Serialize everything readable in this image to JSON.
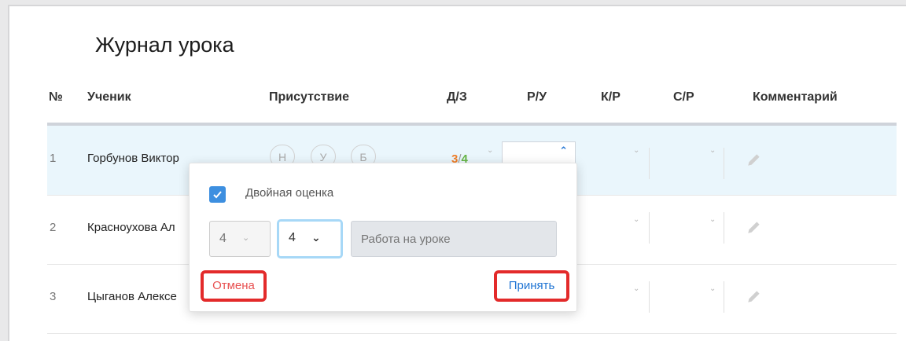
{
  "title": "Журнал урока",
  "columns": [
    "№",
    "Ученик",
    "Присутствие",
    "Д/З",
    "Р/У",
    "К/Р",
    "С/Р",
    "Комментарий"
  ],
  "attendance_options": [
    "Н",
    "У",
    "Б"
  ],
  "rows": [
    {
      "num": "1",
      "name": "Горбунов Виктор"
    },
    {
      "num": "2",
      "name": "Красноухова Ал"
    },
    {
      "num": "3",
      "name": "Цыганов Алексе"
    }
  ],
  "row1_grade": {
    "first": "3",
    "sep": "/",
    "second": "4"
  },
  "popup": {
    "double_grade_label": "Двойная оценка",
    "double_grade_checked": true,
    "grade1": "4",
    "grade2": "4",
    "note_placeholder": "Работа на уроке",
    "cancel": "Отмена",
    "accept": "Принять"
  },
  "colors": {
    "accent": "#1e73d3",
    "checkbox": "#3d8fe0",
    "highlight_border": "#e32a2a",
    "grade_orange": "#ef7d27",
    "grade_green": "#66b646",
    "row_highlight": "#eaf6fc"
  }
}
